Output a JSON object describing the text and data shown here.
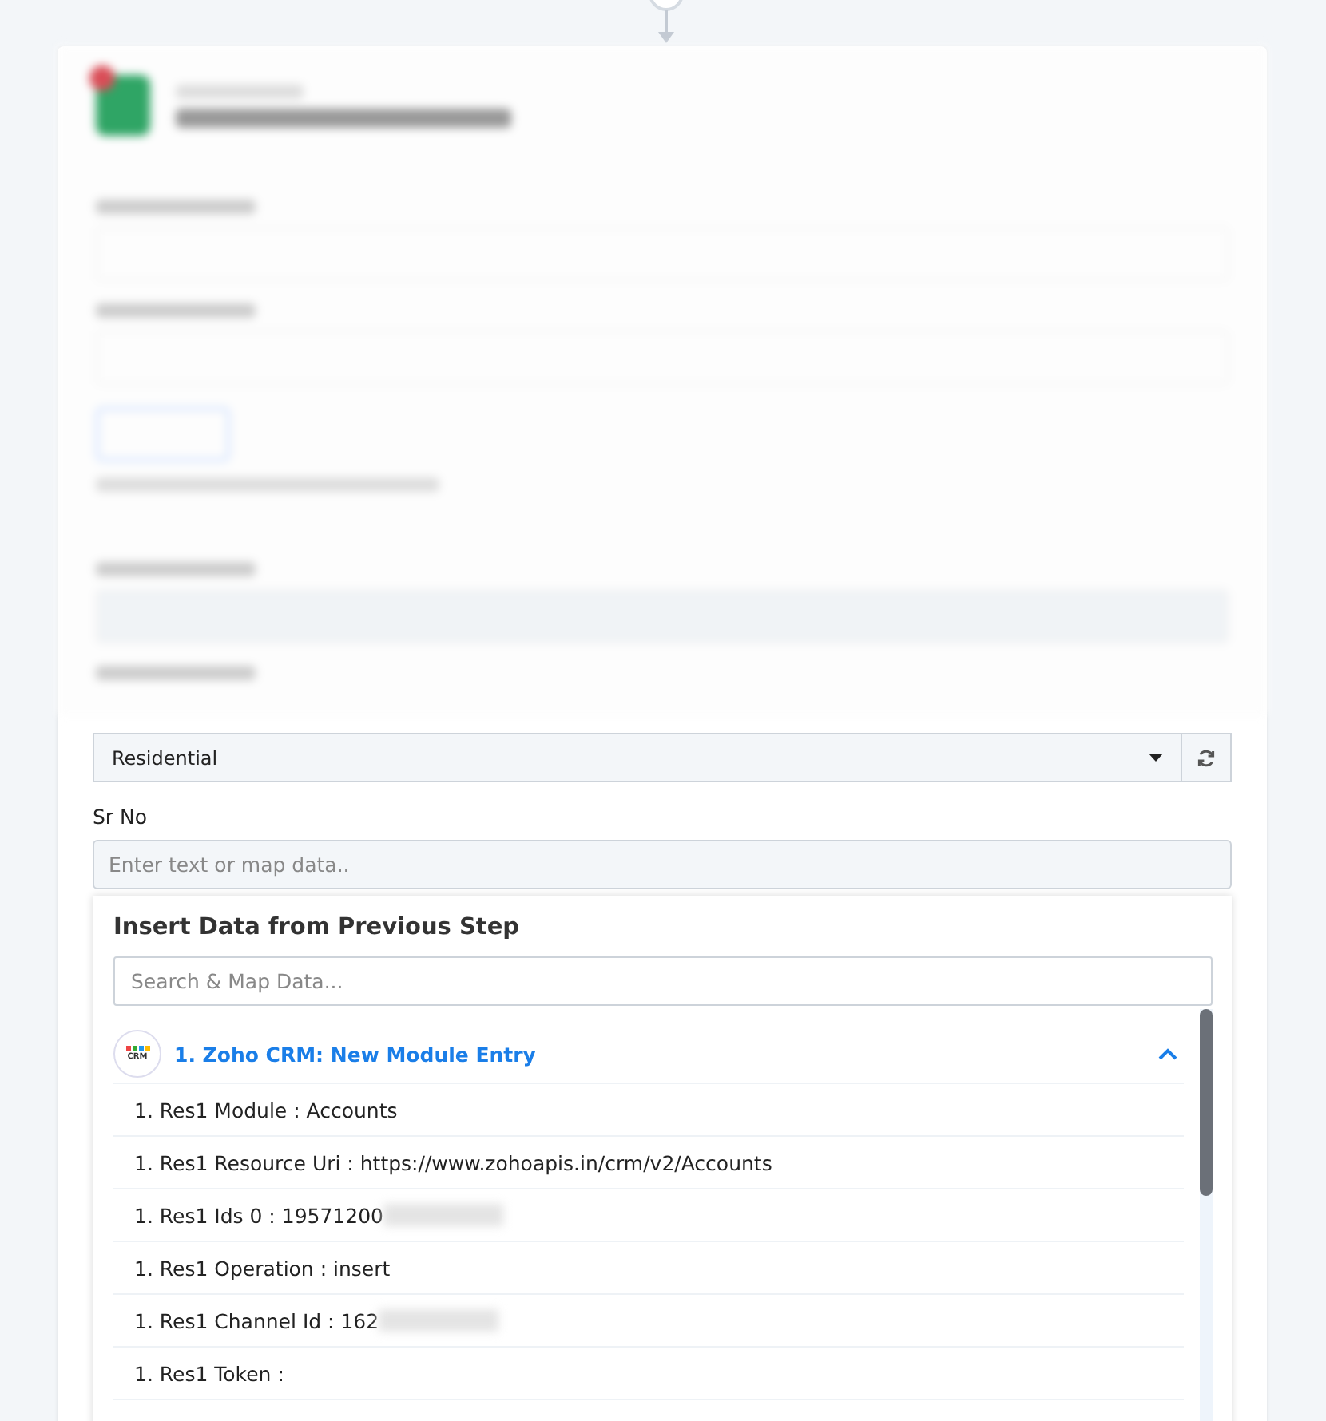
{
  "sheet_field": {
    "value": "Residential"
  },
  "sr_no": {
    "label": "Sr No",
    "placeholder": "Enter text or map data.."
  },
  "insert_panel": {
    "title": "Insert Data from Previous Step",
    "search": {
      "placeholder": "Search & Map Data..."
    },
    "step": {
      "logo_text": "CRM",
      "title": "1. Zoho CRM: New Module Entry",
      "expanded": true,
      "items": [
        {
          "text": "1. Res1 Module : Accounts",
          "redacted": false
        },
        {
          "text": "1. Res1 Resource Uri : https://www.zohoapis.in/crm/v2/Accounts",
          "redacted": false
        },
        {
          "text": "1. Res1 Ids 0 : 19571200",
          "redacted": true
        },
        {
          "text": "1. Res1 Operation : insert",
          "redacted": false
        },
        {
          "text": "1. Res1 Channel Id : 162",
          "redacted": true
        },
        {
          "text": "1. Res1 Token :",
          "redacted": false
        }
      ]
    }
  }
}
